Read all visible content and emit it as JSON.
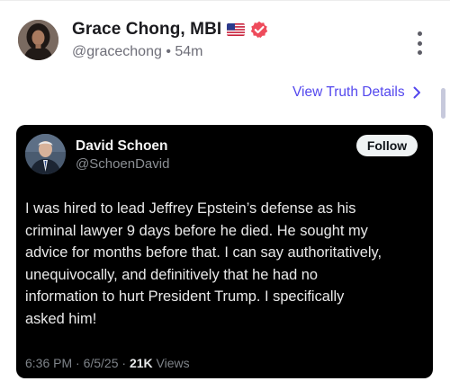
{
  "post": {
    "author_name": "Grace Chong, MBI",
    "flag_icon": "us-flag-icon",
    "verified_icon": "verified-badge-icon",
    "verified_color": "#ee4b5b",
    "handle": "@gracechong",
    "separator": "•",
    "time_ago": "54m",
    "menu_icon": "vertical-ellipsis-icon"
  },
  "details_link": {
    "label": "View Truth Details",
    "icon": "chevron-right-icon",
    "color": "#5448ee"
  },
  "embed": {
    "author_name": "David Schoen",
    "handle": "@SchoenDavid",
    "follow_label": "Follow",
    "text": "I was hired to lead Jeffrey Epstein’s defense as his\ncriminal lawyer 9 days before he died.  He sought my\nadvice for months before that.  I can say authoritatively,\nunequivocally, and definitively that he had no\ninformation to hurt President Trump.  I specifically\nasked him!",
    "meta_prefix": "6:36 PM · 6/5/25 · ",
    "views_count": "21K",
    "views_label": " Views",
    "background": "#000000"
  }
}
